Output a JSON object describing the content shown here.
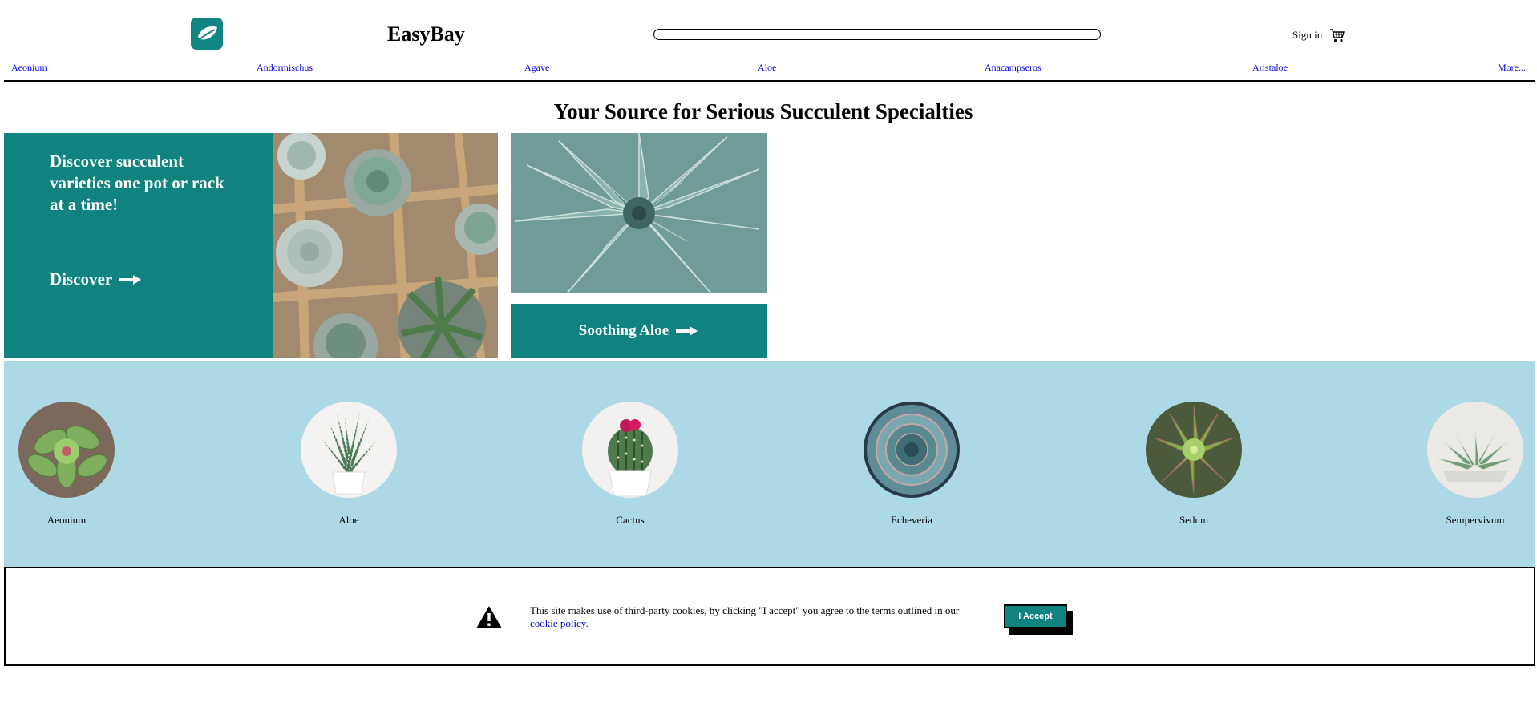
{
  "header": {
    "brand": "EasyBay",
    "logo_icon": "leaf-icon",
    "search": {
      "value": "",
      "placeholder": ""
    },
    "sign_in_label": "Sign in",
    "cart_icon": "shopping-cart-icon"
  },
  "nav": {
    "items": [
      {
        "label": "Aeonium"
      },
      {
        "label": "Andormischus"
      },
      {
        "label": "Agave"
      },
      {
        "label": "Aloe"
      },
      {
        "label": "Anacampseros"
      },
      {
        "label": "Aristaloe"
      },
      {
        "label": "More..."
      }
    ]
  },
  "hero": {
    "headline": "Your Source for Serious Succulent Specialties",
    "promo_text": "Discover succulent varieties one pot or rack at a time!",
    "promo_cta": "Discover",
    "aloe_cta": "Soothing Aloe",
    "arrow_icon": "arrow-right-icon"
  },
  "categories": {
    "items": [
      {
        "label": "Aeonium"
      },
      {
        "label": "Aloe"
      },
      {
        "label": "Cactus"
      },
      {
        "label": "Echeveria"
      },
      {
        "label": "Sedum"
      },
      {
        "label": "Sempervivum"
      }
    ]
  },
  "cookie": {
    "warning_icon": "warning-icon",
    "text": "This site makes use of third-party cookies, by clicking \"I accept\" you agree to the terms outlined in our",
    "link": "cookie policy.",
    "accept_label": "I Accept"
  },
  "colors": {
    "teal": "#108280",
    "light_blue": "#add8e6",
    "link": "#0000ee"
  }
}
